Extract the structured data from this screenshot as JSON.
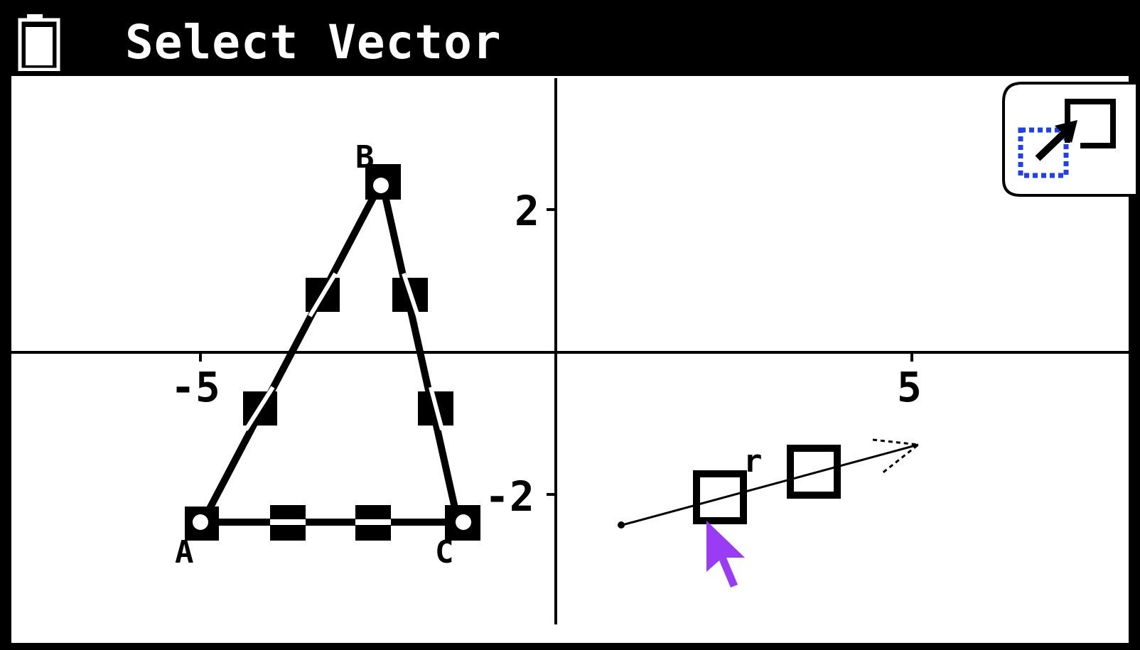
{
  "title_bar": {
    "title": "Select Vector",
    "battery_icon": "battery-icon"
  },
  "graph": {
    "x_tick_labels": [
      "-5",
      "5"
    ],
    "y_tick_labels": [
      "2",
      "-2"
    ],
    "points": {
      "a": "A",
      "b": "B",
      "c": "C"
    },
    "vector_label": "r"
  },
  "toolbar": {
    "view_window_icon": "view-window-icon"
  },
  "colors": {
    "frame": "#000000",
    "background": "#ffffff",
    "accent_blue": "#1f3ff5",
    "cursor_purple": "#9b3cf5"
  },
  "cursor": {
    "icon": "pointer-cursor-icon"
  }
}
